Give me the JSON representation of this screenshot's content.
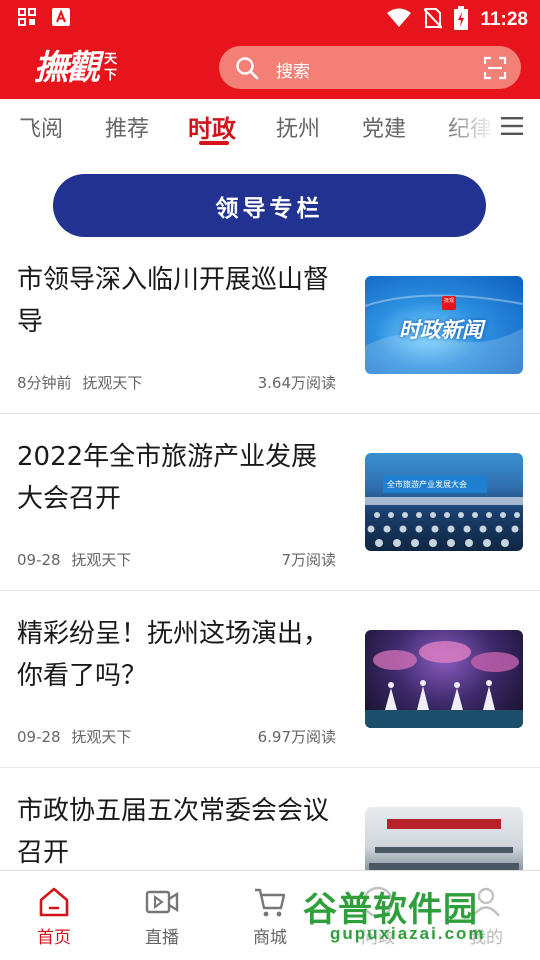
{
  "status_bar": {
    "time": "11:28",
    "icons": [
      "grid-icon",
      "a-app-icon",
      "wifi-icon",
      "no-sim-icon",
      "battery-charging-icon"
    ]
  },
  "header": {
    "logo_text": "撫觀",
    "logo_sub": "天下",
    "search_placeholder": "搜索",
    "colors": {
      "brand_red": "#e8141c",
      "search_bg": "#f28077"
    }
  },
  "tabs": [
    {
      "label": "飞阅",
      "active": false
    },
    {
      "label": "推荐",
      "active": false
    },
    {
      "label": "时政",
      "active": true
    },
    {
      "label": "抚州",
      "active": false
    },
    {
      "label": "党建",
      "active": false
    },
    {
      "label": "纪律",
      "active": false
    }
  ],
  "leader_column": {
    "label": "领导专栏",
    "color": "#213291"
  },
  "news": [
    {
      "title": "市领导深入临川开展巡山督导",
      "time": "8分钟前",
      "source": "抚观天下",
      "reads": "3.64万阅读",
      "thumb_text": "时政新闻",
      "thumb_badge": "抚观"
    },
    {
      "title": "2022年全市旅游产业发展大会召开",
      "time": "09-28",
      "source": "抚观天下",
      "reads": "7万阅读",
      "thumb_text": "全市旅游产业发展大会"
    },
    {
      "title": "精彩纷呈！抚州这场演出，你看了吗？",
      "time": "09-28",
      "source": "抚观天下",
      "reads": "6.97万阅读"
    },
    {
      "title": "市政协五届五次常委会会议召开",
      "time": "",
      "source": "",
      "reads": ""
    }
  ],
  "bottom_nav": [
    {
      "label": "首页",
      "icon": "home-icon",
      "active": true
    },
    {
      "label": "直播",
      "icon": "video-icon",
      "active": false
    },
    {
      "label": "商城",
      "icon": "cart-icon",
      "active": false
    },
    {
      "label": "问政",
      "icon": "question-icon",
      "active": false
    },
    {
      "label": "我的",
      "icon": "user-icon",
      "active": false
    }
  ],
  "watermark": {
    "main": "谷普软件园",
    "sub": "gupuxiazai.com"
  }
}
